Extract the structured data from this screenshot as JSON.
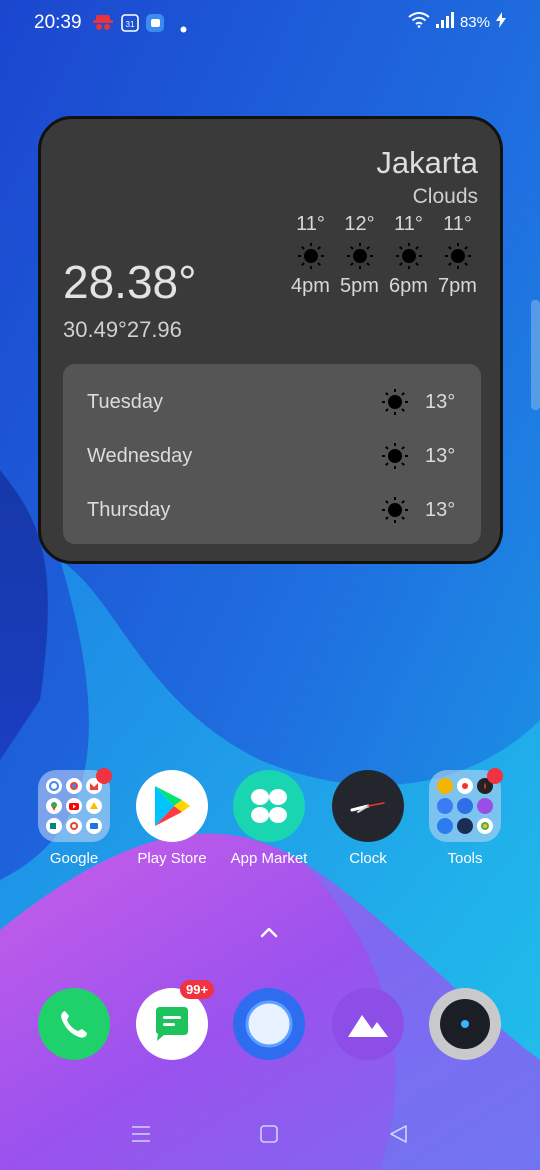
{
  "status_bar": {
    "time": "20:39",
    "calendar_day": "31",
    "battery": "83%",
    "icons": [
      "incognito-icon",
      "calendar-icon",
      "notification-app-icon",
      "dot-icon",
      "wifi-icon",
      "signal-icon",
      "battery-charging-icon"
    ]
  },
  "weather": {
    "city": "Jakarta",
    "condition": "Clouds",
    "current_temp": "28.38°",
    "hi_lo": "30.49°27.96",
    "hourly": [
      {
        "temp": "11°",
        "time": "4pm",
        "icon": "sun-icon"
      },
      {
        "temp": "12°",
        "time": "5pm",
        "icon": "sun-icon"
      },
      {
        "temp": "11°",
        "time": "6pm",
        "icon": "sun-icon"
      },
      {
        "temp": "11°",
        "time": "7pm",
        "icon": "sun-icon"
      }
    ],
    "daily": [
      {
        "day": "Tuesday",
        "temp": "13°",
        "icon": "sun-icon"
      },
      {
        "day": "Wednesday",
        "temp": "13°",
        "icon": "sun-icon"
      },
      {
        "day": "Thursday",
        "temp": "13°",
        "icon": "sun-icon"
      }
    ]
  },
  "apps": [
    {
      "label": "Google",
      "icon": "google-folder-icon",
      "badge": "dot"
    },
    {
      "label": "Play Store",
      "icon": "play-store-icon"
    },
    {
      "label": "App Market",
      "icon": "app-market-icon"
    },
    {
      "label": "Clock",
      "icon": "clock-icon"
    },
    {
      "label": "Tools",
      "icon": "tools-folder-icon",
      "badge": "dot"
    }
  ],
  "dock": [
    {
      "icon": "phone-icon"
    },
    {
      "icon": "messages-icon",
      "badge": "99+"
    },
    {
      "icon": "browser-icon"
    },
    {
      "icon": "gallery-icon"
    },
    {
      "icon": "camera-icon"
    }
  ],
  "nav": [
    "menu-icon",
    "home-icon",
    "back-icon"
  ],
  "colors": {
    "widget_bg": "#3a3a3a",
    "daily_panel_bg": "#555555",
    "badge": "#ef3340",
    "phone_green": "#1fd16b",
    "app_market_teal": "#19d6b1"
  }
}
